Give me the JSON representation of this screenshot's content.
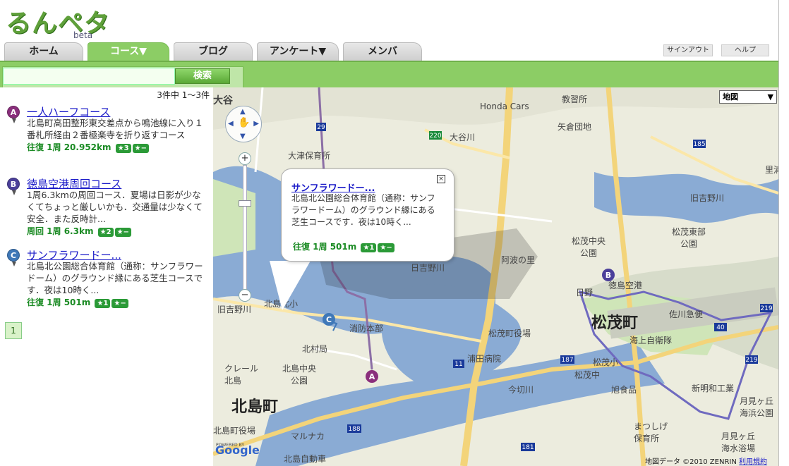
{
  "header": {
    "logo_text": "るんペタ",
    "logo_beta": "beta"
  },
  "nav": {
    "tabs": [
      {
        "label": "ホーム",
        "active": false
      },
      {
        "label": "コース▼",
        "active": true
      },
      {
        "label": "ブログ",
        "active": false
      },
      {
        "label": "アンケート▼",
        "active": false
      },
      {
        "label": "メンバ",
        "active": false
      }
    ],
    "signout_label": "サインアウト",
    "help_label": "ヘルプ"
  },
  "search": {
    "value": "",
    "button_label": "検索"
  },
  "results": {
    "count_text": "3件中 1〜3件",
    "items": [
      {
        "marker": "A",
        "title": "一人ハーフコース",
        "description": "北島町高田整形東交差点から鳴池線に入り１番札所経由２番極楽寺を折り返すコース",
        "meta": "往復 1周 20.952km",
        "badges": [
          "★3",
          "★−"
        ]
      },
      {
        "marker": "B",
        "title": "徳島空港周回コース",
        "description": "1周6.3kmの周回コース．夏場は日影が少なくてちょっと厳しいかも．交通量は少なくて安全．また反時計...",
        "meta": "周回 1周 6.3km",
        "badges": [
          "★2",
          "★−"
        ]
      },
      {
        "marker": "C",
        "title": "サンフラワードー...",
        "description": "北島北公園総合体育館（通称：サンフラワードーム）のグラウンド縁にある芝生コースです．夜は10時く...",
        "meta": "往復 1周 501m",
        "badges": [
          "★1",
          "★−"
        ]
      }
    ],
    "page": "1"
  },
  "map": {
    "type_select": "地図",
    "popup": {
      "title": "サンフラワードー...",
      "description": "北島北公園総合体育館（通称：サンフラワードーム）のグラウンド縁にある芝生コースです．夜は10時く...",
      "meta": "往復 1周 501m",
      "badges": [
        "★1",
        "★−"
      ]
    },
    "attribution": "地図データ ©2010 ZENRIN",
    "attribution_link": "利用規約",
    "google_powered": "POWERED BY",
    "google_logo": "Google",
    "markers": [
      "A",
      "B",
      "C"
    ],
    "labels": {
      "kitajima": "北島町",
      "matsushige": "松茂町",
      "honda": "Honda Cars",
      "ootani": "大谷",
      "ootanigawa": "大谷川",
      "ootsu": "大津保育所",
      "kyuyoshino": "旧吉野川",
      "kyuyoshino2": "旧吉野川",
      "kyuyoshino3": "旧吉野川",
      "yaguchi": "矢倉団地",
      "kyoiku": "教習所",
      "matsushige_chuo": "松茂中央\n公園",
      "matsushige_tobu": "松茂東部\n公園",
      "tokushima_kuko": "徳島空港",
      "hiyoshi": "日吉野川",
      "awa": "阿波の里",
      "kitajimakita": "北島北小",
      "shobo": "消防本部",
      "kitamura": "北村局",
      "kitajima_chuo": "北島中央\n公園",
      "matsushige_yakuba": "松茂町役場",
      "urata": "浦田病院",
      "imakiri": "今切川",
      "kaijo": "海上自衛隊",
      "sagawa": "佐川急便",
      "matsushige_sho": "松茂小",
      "matsushige_chu": "松茂中",
      "asahi": "旭食品",
      "shinmei": "新明和工業",
      "tsukimi": "月見ヶ丘\n海浜公園",
      "tsukimi2": "月見ヶ丘\n海水浴場",
      "matsushige_hoiku": "まつしげ\n保育所",
      "kitajima_yakuba": "北島町役場",
      "marunaka": "マルナカ",
      "jidosha": "北島自動車",
      "nichiya": "日野",
      "kure": "クレール\n北島",
      "satogawa": "里浦",
      "route_220": "220",
      "route_185": "185",
      "route_11": "11",
      "route_187": "187",
      "route_188": "188",
      "route_181": "181",
      "route_219": "219",
      "route_40": "40",
      "route_219b": "219",
      "route_29": "29"
    }
  },
  "colors": {
    "accent_green": "#8ccd65",
    "link_blue": "#1a1ac8",
    "meta_green": "#1b8b24",
    "marker_A": "#8a2f7c",
    "marker_B": "#4b3f9a",
    "marker_C": "#3f78b8",
    "water": "#8aabd4",
    "land": "#ececde",
    "road": "#f3d47a"
  }
}
